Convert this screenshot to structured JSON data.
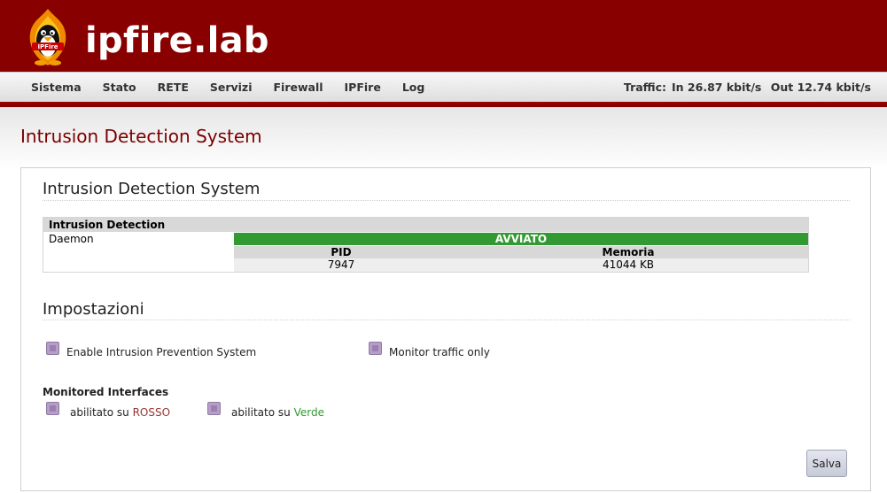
{
  "header": {
    "title": "ipfire.lab",
    "logo_icon": "ipfire-penguin-flame-logo",
    "logo_text": "IPFire"
  },
  "nav": {
    "items": [
      {
        "label": "Sistema"
      },
      {
        "label": "Stato"
      },
      {
        "label": "RETE"
      },
      {
        "label": "Servizi"
      },
      {
        "label": "Firewall"
      },
      {
        "label": "IPFire"
      },
      {
        "label": "Log"
      }
    ],
    "traffic": {
      "label": "Traffic:",
      "in": "In 26.87 kbit/s",
      "out": "Out 12.74 kbit/s"
    }
  },
  "page": {
    "title": "Intrusion Detection System"
  },
  "panel": {
    "section1_title": "Intrusion Detection System",
    "table": {
      "header": "Intrusion Detection",
      "daemon_label": "Daemon",
      "status": "AVVIATO",
      "columns": [
        "PID",
        "Memoria"
      ],
      "values": [
        "7947",
        "41044 KB"
      ]
    },
    "section2_title": "Impostazioni",
    "settings": {
      "enable_ips_label": "Enable Intrusion Prevention System",
      "monitor_only_label": "Monitor traffic only"
    },
    "monitored": {
      "heading": "Monitored Interfaces",
      "prefix": "abilitato su",
      "red_name": "ROSSO",
      "green_name": "Verde"
    },
    "save_label": "Salva"
  },
  "colors": {
    "header_bg": "#890000",
    "title_red": "#7a0000",
    "status_green": "#339933",
    "red_zone": "#993333",
    "green_zone": "#339933"
  }
}
